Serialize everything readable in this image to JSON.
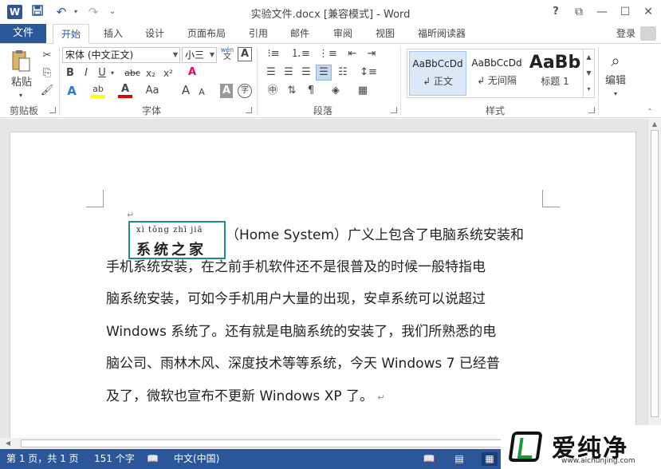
{
  "window": {
    "title": "实验文件.docx [兼容模式] - Word",
    "help": "?",
    "restore_ribbon": "⧉",
    "minimize": "—",
    "maximize": "☐",
    "close": "✕"
  },
  "quick_access": {
    "app_icon": "W",
    "save_icon": "💾",
    "undo_icon": "↶",
    "redo_icon": "↷",
    "customize_icon": "⌄"
  },
  "tabs": {
    "file": "文件",
    "items": [
      "开始",
      "插入",
      "设计",
      "页面布局",
      "引用",
      "邮件",
      "审阅",
      "视图",
      "福昕阅读器"
    ],
    "active": "开始",
    "login": "登录"
  },
  "ribbon": {
    "clipboard": {
      "label": "剪贴板",
      "paste": "粘贴",
      "cut_icon": "✂",
      "copy_icon": "⎘",
      "painter_icon": "🖌"
    },
    "font": {
      "label": "字体",
      "font_name": "宋体 (中文正文)",
      "font_size": "小三",
      "pinyin_icon": "wén",
      "border_icon": "A",
      "bold": "B",
      "italic": "I",
      "underline": "U",
      "strike": "abc",
      "subscript": "x₂",
      "superscript": "x²",
      "clear_icon": "A",
      "effects": "A",
      "highlight": "ab",
      "font_color": "A",
      "case": "Aa",
      "grow": "A",
      "shrink": "A",
      "shade": "A",
      "enclose": "字"
    },
    "paragraph": {
      "label": "段落"
    },
    "styles": {
      "label": "样式",
      "items": [
        {
          "sample": "AaBbCcDd",
          "name": "↲ 正文"
        },
        {
          "sample": "AaBbCcDd",
          "name": "↲ 无间隔"
        },
        {
          "sample": "AaBb",
          "name": "标题 1"
        }
      ]
    },
    "editing": {
      "label": "编辑"
    },
    "colors": {
      "highlight": "#ffff00",
      "font_color": "#e00000",
      "accent": "#2b579a"
    }
  },
  "document": {
    "empty_para_mark": "↵",
    "ruby": {
      "pinyin": "xì tǒng zhī jiā",
      "base": "系统之家"
    },
    "lines": [
      "（Home System）广义上包含了电脑系统安装和",
      "手机系统安装，在之前手机软件还不是很普及的时候一般特指电",
      "脑系统安装，可如今手机用户大量的出现，安卓系统可以说超过",
      "Windows 系统了。还有就是电脑系统的安装了，我们所熟悉的电",
      "脑公司、雨林木风、深度技术等等系统，今天 Windows 7 已经普",
      "及了，微软也宣布不更新 Windows XP 了。"
    ],
    "end_mark": "↵"
  },
  "status": {
    "page": "第 1 页，共 1 页",
    "words": "151 个字",
    "proof_icon": "📖",
    "language": "中文(中国)"
  },
  "watermark": {
    "text": "爱纯净",
    "url": "www.aichunjing.com"
  }
}
